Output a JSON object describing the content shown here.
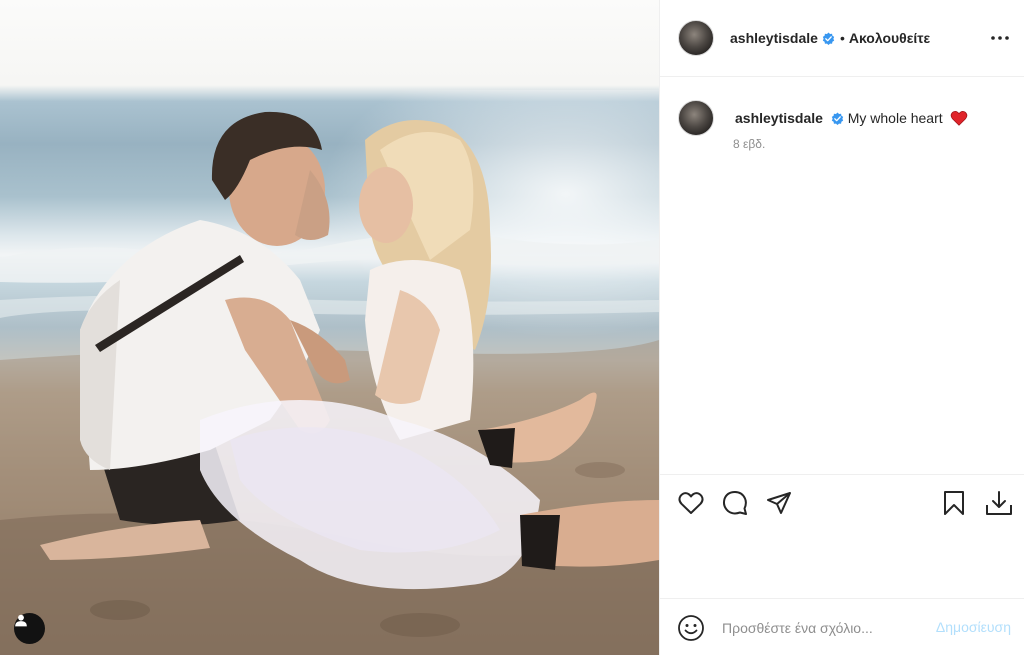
{
  "post": {
    "username": "ashleytisdale",
    "separator": "•",
    "follow_status": "Ακολουθείτε",
    "caption_username": "ashleytisdale",
    "caption_text": "My whole heart",
    "caption_emoji": "❤️",
    "timestamp": "8 εβδ."
  },
  "comment": {
    "placeholder": "Προσθέστε ένα σχόλιο...",
    "post_label": "Δημοσίευση"
  },
  "icons": {
    "verified": "verified-badge-icon",
    "more": "more-options-icon",
    "like": "heart-icon",
    "comment": "comment-bubble-icon",
    "share": "paper-plane-icon",
    "save": "bookmark-icon",
    "download": "download-icon",
    "emoji": "smiley-icon",
    "tagged": "user-tag-icon"
  },
  "colors": {
    "verified_blue": "#3897f0",
    "post_button_disabled": "#b2dffc",
    "secondary_text": "#8e8e8e",
    "heart_red": "#e0242a"
  }
}
